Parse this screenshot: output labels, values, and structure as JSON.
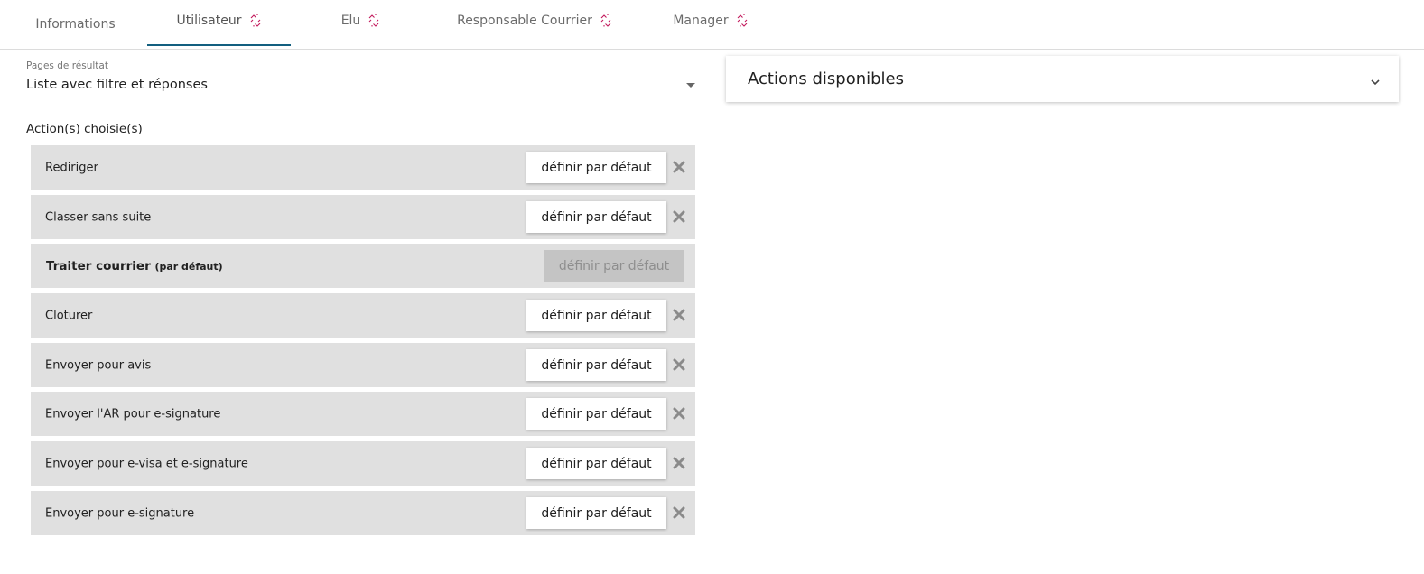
{
  "tabs": [
    {
      "label": "Informations",
      "icon": null,
      "active": false
    },
    {
      "label": "Utilisateur",
      "icon": "unlink-icon",
      "active": true
    },
    {
      "label": "Elu",
      "icon": "unlink-icon",
      "active": false
    },
    {
      "label": "Responsable Courrier",
      "icon": "unlink-icon",
      "active": false
    },
    {
      "label": "Manager",
      "icon": "unlink-icon",
      "active": false
    }
  ],
  "result_page": {
    "label": "Pages de résultat",
    "value": "Liste avec filtre et réponses"
  },
  "chosen_actions": {
    "title": "Action(s) choisie(s)",
    "set_default_label": "définir par défaut",
    "default_suffix": "(par défaut)",
    "items": [
      {
        "label": "Rediriger",
        "is_default": false
      },
      {
        "label": "Classer sans suite",
        "is_default": false
      },
      {
        "label": "Traiter courrier",
        "is_default": true
      },
      {
        "label": "Cloturer",
        "is_default": false
      },
      {
        "label": "Envoyer pour avis",
        "is_default": false
      },
      {
        "label": "Envoyer l'AR pour e-signature",
        "is_default": false
      },
      {
        "label": "Envoyer pour e-visa et e-signature",
        "is_default": false
      },
      {
        "label": "Envoyer pour e-signature",
        "is_default": false
      }
    ]
  },
  "available_actions": {
    "title": "Actions disponibles",
    "icon": "chevron-down-icon"
  },
  "colors": {
    "active_tab_underline": "#135f7f",
    "unlink_icon": "#c2185b",
    "row_background": "#e0e0e0",
    "disabled_button": "#c4c4c4"
  }
}
